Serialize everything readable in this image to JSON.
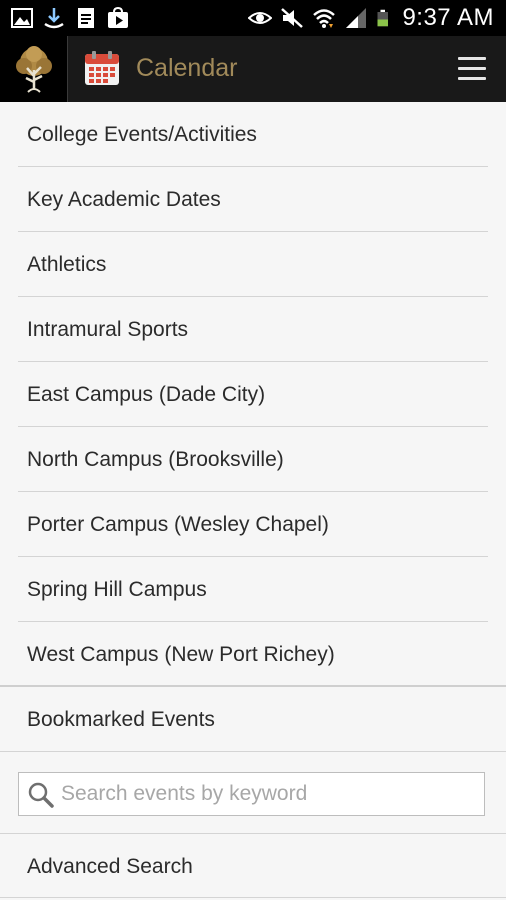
{
  "status_bar": {
    "time": "9:37 AM",
    "left_icons": [
      "image-icon",
      "download-icon",
      "document-icon",
      "play-store-icon"
    ],
    "right_icons": [
      "eye-icon",
      "mute-icon",
      "wifi-icon",
      "signal-icon",
      "battery-icon"
    ]
  },
  "action_bar": {
    "title": "Calendar",
    "title_color": "#a18a5a",
    "background": "#191919"
  },
  "menu": {
    "items": [
      "College Events/Activities",
      "Key Academic Dates",
      "Athletics",
      "Intramural Sports",
      "East Campus (Dade City)",
      "North Campus (Brooksville)",
      "Porter Campus (Wesley Chapel)",
      "Spring Hill Campus",
      "West Campus (New Port Richey)"
    ],
    "bookmarked": "Bookmarked Events"
  },
  "search": {
    "placeholder": "Search events by keyword",
    "value": ""
  },
  "advanced_search": "Advanced Search"
}
